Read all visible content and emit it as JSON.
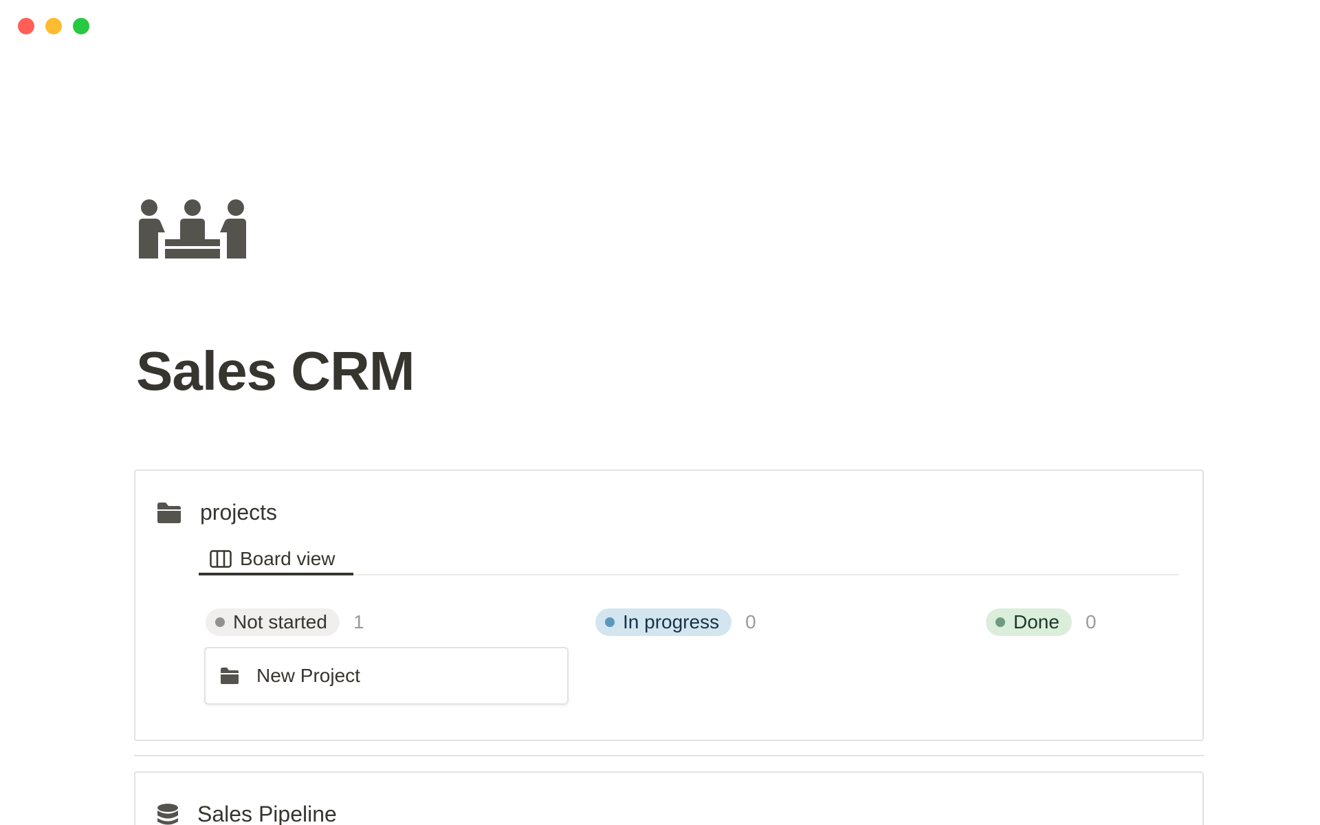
{
  "page": {
    "title": "Sales CRM",
    "icon": "meeting-people-icon"
  },
  "projects_block": {
    "icon": "folder-icon",
    "title": "projects",
    "views": [
      {
        "icon": "board-icon",
        "label": "Board view",
        "active": true
      }
    ],
    "groups": [
      {
        "label": "Not started",
        "count": "1",
        "color": "#91918e",
        "background": "#f0efed",
        "cards": [
          {
            "icon": "folder-icon",
            "title": "New Project"
          }
        ]
      },
      {
        "label": "In progress",
        "count": "0",
        "color": "#5b97bd",
        "background": "#d3e5ef",
        "cards": []
      },
      {
        "label": "Done",
        "count": "0",
        "color": "#6c9b7d",
        "background": "#dbeddb",
        "cards": []
      }
    ]
  },
  "pipeline_block": {
    "icon": "database-icon",
    "title": "Sales Pipeline"
  },
  "colors": {
    "text": "#37352f",
    "border": "#e3e2df",
    "close": "#ff5f57",
    "minimize": "#febc2e",
    "maximize": "#28c840"
  }
}
